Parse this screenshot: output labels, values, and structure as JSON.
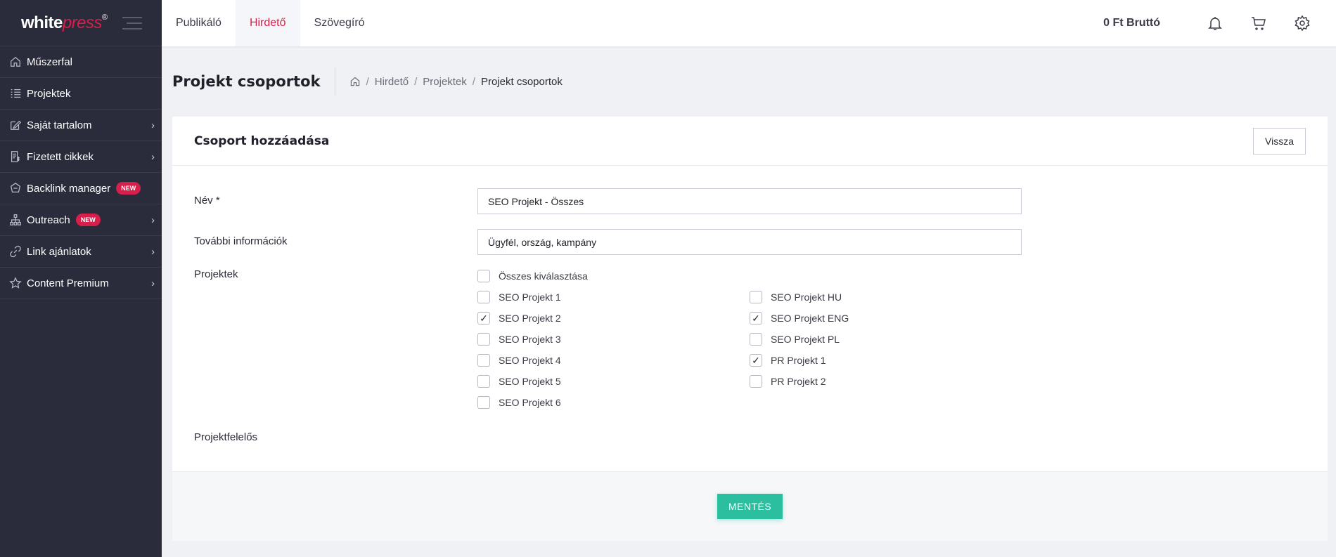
{
  "logo": {
    "white": "white",
    "press": "press",
    "reg": "®"
  },
  "sidebar": {
    "items": [
      {
        "label": "Műszerfal",
        "icon": "home-icon",
        "badge": "",
        "chevron": ""
      },
      {
        "label": "Projektek",
        "icon": "list-icon",
        "badge": "",
        "chevron": ""
      },
      {
        "label": "Saját tartalom",
        "icon": "edit-icon",
        "badge": "",
        "chevron": "›"
      },
      {
        "label": "Fizetett cikkek",
        "icon": "paid-articles-icon",
        "badge": "",
        "chevron": "›"
      },
      {
        "label": "Backlink manager",
        "icon": "backlink-icon",
        "badge": "NEW",
        "chevron": ""
      },
      {
        "label": "Outreach",
        "icon": "outreach-icon",
        "badge": "NEW",
        "chevron": "›"
      },
      {
        "label": "Link ajánlatok",
        "icon": "link-icon",
        "badge": "",
        "chevron": "›"
      },
      {
        "label": "Content Premium",
        "icon": "star-icon",
        "badge": "",
        "chevron": "›"
      }
    ]
  },
  "topbar": {
    "tabs": [
      "Publikáló",
      "Hirdető",
      "Szövegíró"
    ],
    "active_tab": "Hirdető",
    "balance": "0 Ft Bruttó"
  },
  "page": {
    "title": "Projekt csoportok",
    "breadcrumb": [
      "Hirdető",
      "Projektek",
      "Projekt csoportok"
    ]
  },
  "card": {
    "title": "Csoport hozzáadása",
    "back_label": "Vissza",
    "save_label": "MENTÉS"
  },
  "form": {
    "name_label": "Név *",
    "name_value": "SEO Projekt - Összes",
    "info_label": "További információk",
    "info_value": "Ügyfél, ország, kampány",
    "projects_label": "Projektek",
    "select_all_label": "Összes kiválasztása",
    "select_all_checked": false,
    "owner_label": "Projektfelelős",
    "projects_col1": [
      {
        "label": "SEO Projekt 1",
        "checked": false
      },
      {
        "label": "SEO Projekt 2",
        "checked": true
      },
      {
        "label": "SEO Projekt 3",
        "checked": false
      },
      {
        "label": "SEO Projekt 4",
        "checked": false
      },
      {
        "label": "SEO Projekt 5",
        "checked": false
      },
      {
        "label": "SEO Projekt 6",
        "checked": false
      }
    ],
    "projects_col2": [
      {
        "label": "SEO Projekt HU",
        "checked": false
      },
      {
        "label": "SEO Projekt ENG",
        "checked": true
      },
      {
        "label": "SEO Projekt PL",
        "checked": false
      },
      {
        "label": "PR Projekt 1",
        "checked": true
      },
      {
        "label": "PR Projekt 2",
        "checked": false
      }
    ]
  },
  "colors": {
    "brand": "#d61f4b",
    "sidebar": "#2a2c3b",
    "save": "#2bbfa0"
  }
}
